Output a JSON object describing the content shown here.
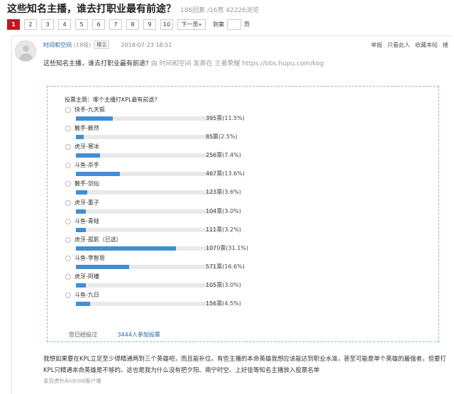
{
  "thread": {
    "title": "这些知名主播，谁去打职业最有前途？",
    "meta": "186回复 /16亮  42226浏览"
  },
  "pager": {
    "pages": [
      "1",
      "2",
      "3",
      "4",
      "5",
      "6",
      "7",
      "8",
      "9",
      "10"
    ],
    "current": "1",
    "next_label": "下一页»",
    "goto_label": "到第",
    "page_unit": "页"
  },
  "post": {
    "author": "时间和空间",
    "level": "(18级)",
    "floor_badge": "楼主",
    "time": "2018-07-23 18:51",
    "actions": [
      "举报",
      "只看此人",
      "收藏本帖",
      "楼"
    ],
    "heading": "这些知名主播，谁去打职业最有前途?",
    "source": "由 时间和空间 发表在 王者荣耀 https://bbs.hupu.com/kog",
    "body": "我想如果要在KPL立足至少得精通两到三个英雄吧，而且能补位。有些主播的本命英雄我想应该能达到职业水准，甚至可能是单个英雄的最强者，但要打KPL只精通本命英雄是不够的。这也是我为什么没有把夕阳、南宁时空、上好佳等知名主播放入投票名单",
    "client": "发自虎扑Android客户端"
  },
  "poll": {
    "question": "投票主题：哪个主播打KPL最有前途?",
    "options": [
      {
        "name": "快手-九天狐",
        "result": "395票(11.5%)",
        "pct": 11.5
      },
      {
        "name": "触手-薮然",
        "result": "85票(2.5%)",
        "pct": 2.5
      },
      {
        "name": "虎牙-寒冰",
        "result": "256票(7.4%)",
        "pct": 7.4
      },
      {
        "name": "斗鱼-杀手",
        "result": "467票(13.6%)",
        "pct": 13.6
      },
      {
        "name": "触手-剑仙",
        "result": "123票(3.6%)",
        "pct": 3.6
      },
      {
        "name": "虎牙-董子",
        "result": "104票(3.0%)",
        "pct": 3.0
      },
      {
        "name": "斗鱼-青蛙",
        "result": "111票(3.2%)",
        "pct": 3.2
      },
      {
        "name": "虎牙-孤影（已选）",
        "result": "1070票(31.1%)",
        "pct": 31.1
      },
      {
        "name": "斗鱼-李智恩",
        "result": "571票(16.6%)",
        "pct": 16.6
      },
      {
        "name": "虎牙-阿槽",
        "result": "105票(3.0%)",
        "pct": 3.0
      },
      {
        "name": "斗鱼-九日",
        "result": "156票(4.5%)",
        "pct": 4.5
      }
    ],
    "voted_label": "您已经投过",
    "participants": "3444人参加投票",
    "bar_color": "#3e8fd6",
    "border_color": "#7cc6a8"
  }
}
